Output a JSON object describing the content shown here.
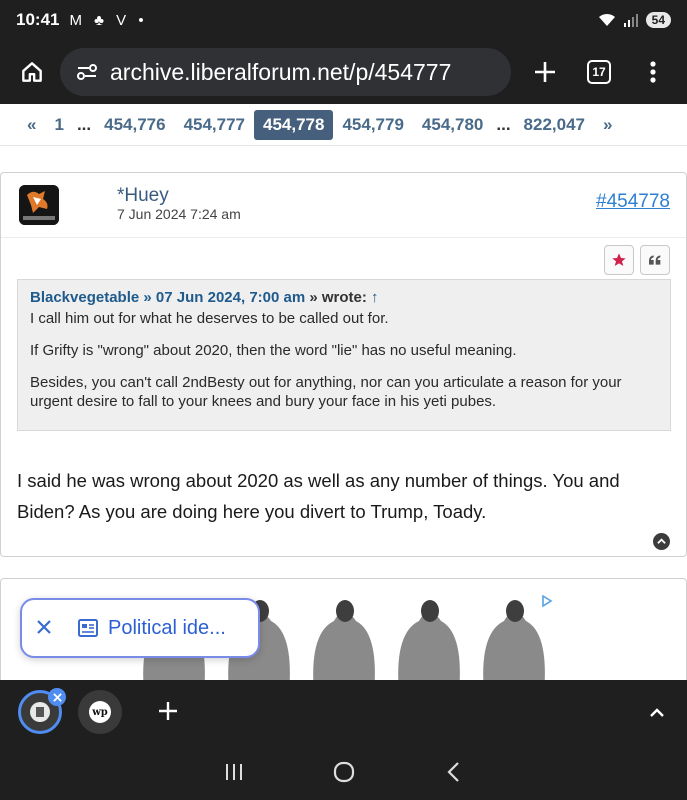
{
  "status_bar": {
    "time": "10:41",
    "notification_glyphs": "M ♣ V •",
    "wifi_label": "6",
    "battery": "54"
  },
  "address_bar": {
    "url": "archive.liberalforum.net/p/454777",
    "tab_count": "17"
  },
  "pagination": {
    "prev_label": "«",
    "next_label": "»",
    "ellipsis": "...",
    "pages": [
      "1",
      "454,776",
      "454,777",
      "454,778",
      "454,779",
      "454,780",
      "822,047"
    ],
    "current": "454,778"
  },
  "post": {
    "author": "*Huey",
    "date": "7 Jun 2024 7:24 am",
    "post_id": "#454778",
    "quote": {
      "author": "Blackvegetable",
      "sep": "»",
      "date": "07 Jun 2024, 7:00 am",
      "wrote": "» wrote:",
      "arrow": "↑",
      "paragraphs": [
        "I call him out for what he deserves to be called out for.",
        "If Grifty is \"wrong\" about 2020, then the word \"lie\" has no useful meaning.",
        "Besides, you can't call 2ndBesty out for anything, nor can you articulate a reason for your urgent desire to fall to your knees and bury your face in his yeti pubes."
      ]
    },
    "body": "I said he was wrong about 2020 as well as any number of things.  You and Biden?  As you are doing here you divert to Trump, Toady."
  },
  "float_chip": {
    "label": "Political ide..."
  },
  "icons": {
    "home": "home-icon",
    "site_info": "site-settings-icon",
    "star": "star-icon",
    "quote": "quote-icon",
    "scroll_top": "chevron-up-icon",
    "close": "close-icon",
    "article": "article-icon"
  },
  "colors": {
    "chrome_bg": "#1f1f1f",
    "link_blue": "#2d7fd1",
    "page_current_bg": "#455f7c",
    "chip_blue": "#2c5fd6",
    "star_red": "#d0224a"
  }
}
